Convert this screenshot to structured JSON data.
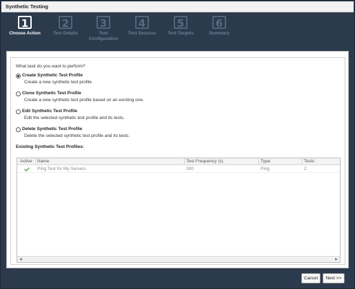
{
  "window": {
    "title": "Synthetic Testing"
  },
  "wizard": {
    "steps": [
      {
        "num": "1",
        "label": "Choose Action",
        "active": true
      },
      {
        "num": "2",
        "label": "Test Details",
        "active": false
      },
      {
        "num": "3",
        "label": "Test\nConfiguration",
        "label_line1": "Test",
        "label_line2": "Configuration",
        "active": false
      },
      {
        "num": "4",
        "label": "Test Sources",
        "active": false
      },
      {
        "num": "5",
        "label": "Test Targets",
        "active": false
      },
      {
        "num": "6",
        "label": "Summary",
        "active": false
      }
    ]
  },
  "form": {
    "question": "What task do you want to perform?",
    "options": [
      {
        "title": "Create Synthetic Test Profile",
        "desc": "Create a new synthetic test profile.",
        "checked": true
      },
      {
        "title": "Clone Synthetic Test Profile",
        "desc": "Create a new synthetic test profile based on an existing one.",
        "checked": false
      },
      {
        "title": "Edit Synthetic Test Profile",
        "desc": "Edit the selected synthetic test profile and its tests.",
        "checked": false
      },
      {
        "title": "Delete Synthetic Test Profile",
        "desc": "Delete the selected synthetic test profile and its tests.",
        "checked": false
      }
    ],
    "existing_label": "Existing Synthetic Test Profiles:"
  },
  "grid": {
    "columns": [
      "Active",
      "Name",
      "Test Frequency (s)",
      "Type",
      "Tests"
    ],
    "rows": [
      {
        "active": "check-icon",
        "name": "Ping Test for My Servers",
        "frequency": "300",
        "type": "Ping",
        "tests": "2"
      }
    ]
  },
  "footer": {
    "cancel_label": "Cancel",
    "next_label": "Next >>"
  },
  "colors": {
    "header_bg": "#2c3a4d",
    "active_step": "#ffffff",
    "inactive_step": "#596a80",
    "check": "#5cb85c"
  }
}
